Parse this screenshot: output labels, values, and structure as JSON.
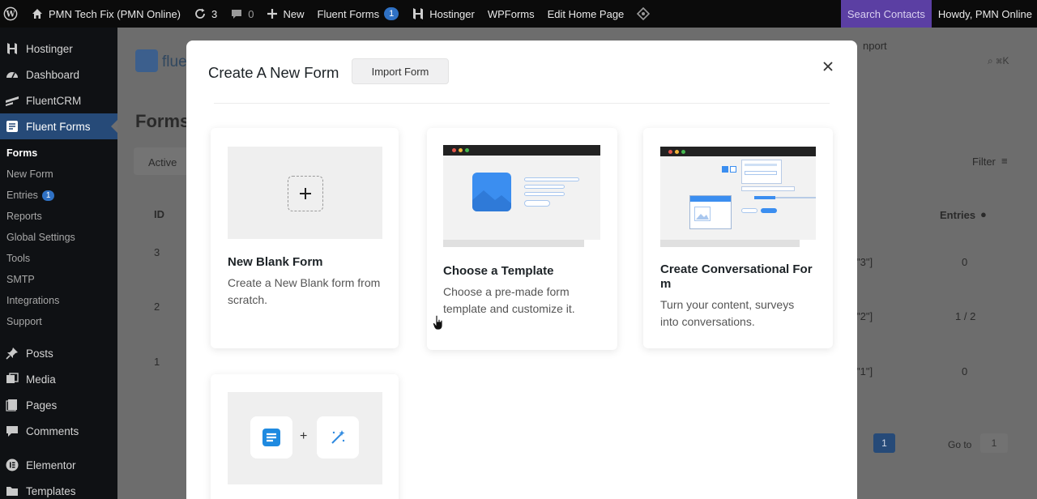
{
  "adminbar": {
    "site_name": "PMN Tech Fix (PMN Online)",
    "updates_count": "3",
    "comments_count": "0",
    "new_label": "New",
    "fluent_forms_label": "Fluent Forms",
    "fluent_forms_badge": "1",
    "hostinger_label": "Hostinger",
    "wpforms_label": "WPForms",
    "edit_home_label": "Edit Home Page",
    "search_contacts_label": "Search Contacts",
    "howdy_label": "Howdy, PMN Online"
  },
  "sidebar": {
    "items": [
      {
        "label": "Hostinger",
        "icon": "hostinger-icon"
      },
      {
        "label": "Dashboard",
        "icon": "dashboard-icon"
      },
      {
        "label": "FluentCRM",
        "icon": "fluentcrm-icon"
      },
      {
        "label": "Fluent Forms",
        "icon": "fluent-forms-icon"
      }
    ],
    "submenu": [
      {
        "label": "Forms"
      },
      {
        "label": "New Form"
      },
      {
        "label": "Entries",
        "badge": "1"
      },
      {
        "label": "Reports"
      },
      {
        "label": "Global Settings"
      },
      {
        "label": "Tools"
      },
      {
        "label": "SMTP"
      },
      {
        "label": "Integrations"
      },
      {
        "label": "Support"
      }
    ],
    "items2": [
      {
        "label": "Posts",
        "icon": "pin-icon"
      },
      {
        "label": "Media",
        "icon": "media-icon"
      },
      {
        "label": "Pages",
        "icon": "pages-icon"
      },
      {
        "label": "Comments",
        "icon": "comments-icon"
      },
      {
        "label": "Elementor",
        "icon": "elementor-icon"
      },
      {
        "label": "Templates",
        "icon": "templates-icon"
      }
    ]
  },
  "background": {
    "logo_text": "fluen",
    "page_title": "Forms",
    "tab_active": "Active",
    "filter_label": "Filter",
    "col_id": "ID",
    "col_entries": "Entries",
    "import_partial": "nport",
    "rows": [
      {
        "id": "3",
        "shortcode": "\"3\"]",
        "entries": "0"
      },
      {
        "id": "2",
        "shortcode": "\"2\"]",
        "entries": "1 / 2"
      },
      {
        "id": "1",
        "shortcode": "\"1\"]",
        "entries": "0"
      }
    ],
    "page_number": "1",
    "goto_label": "Go to",
    "goto_value": "1"
  },
  "modal": {
    "title": "Create A New Form",
    "import_label": "Import Form",
    "cards": [
      {
        "title": "New Blank Form",
        "desc": "Create a New Blank form from scratch."
      },
      {
        "title": "Choose a Template",
        "desc": "Choose a pre-made form template and customize it."
      },
      {
        "title": "Create Conversational For m",
        "desc": "Turn your content, surveys into conversations."
      }
    ]
  },
  "colors": {
    "accent": "#2f71c4",
    "template_blue": "#3b8ef0",
    "admin_bar": "#0b0b0b",
    "sidebar": "#0f1114",
    "active_menu": "#264a78",
    "search_contacts": "#5b3fa3"
  }
}
